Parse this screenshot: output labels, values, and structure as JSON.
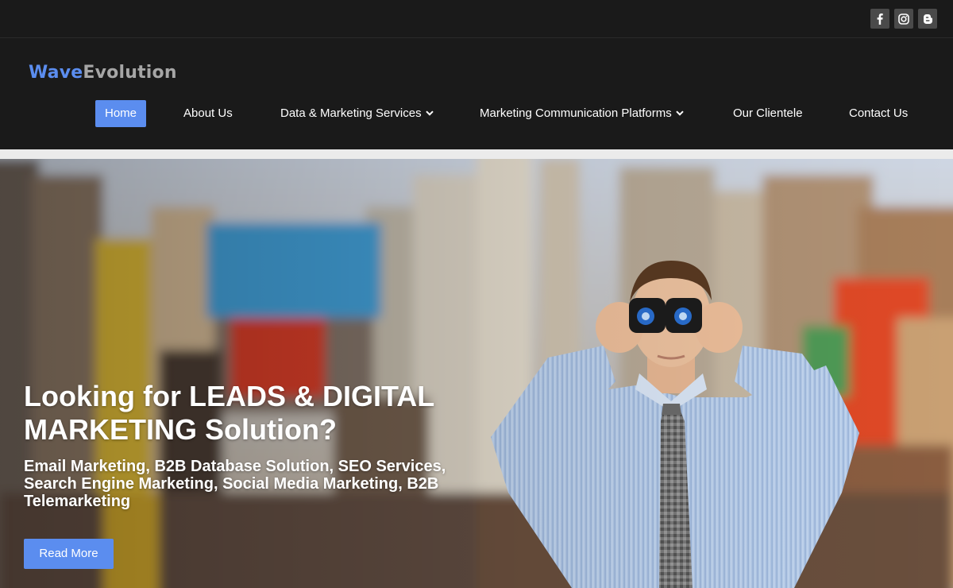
{
  "social": [
    {
      "name": "facebook",
      "icon": "facebook-icon"
    },
    {
      "name": "instagram",
      "icon": "instagram-icon"
    },
    {
      "name": "blogger",
      "icon": "blogger-icon"
    }
  ],
  "brand": {
    "part1": "Wave",
    "part2": "Evolution",
    "color1": "#5b8def",
    "color2": "#a6a6a6"
  },
  "nav": {
    "items": [
      {
        "label": "Home",
        "active": true
      },
      {
        "label": "About Us"
      },
      {
        "label": "Data & Marketing Services",
        "dropdown": true
      },
      {
        "label": "Marketing Communication Platforms",
        "dropdown": true
      },
      {
        "label": "Our Clientele"
      },
      {
        "label": "Contact Us"
      }
    ]
  },
  "hero": {
    "title": "Looking for LEADS & DIGITAL MARKETING Solution?",
    "subtitle": "Email Marketing, B2B Database Solution, SEO Services, Search Engine Marketing, Social Media Marketing, B2B Telemarketing",
    "button": "Read More"
  },
  "colors": {
    "accent": "#5b8def",
    "header_bg": "#1a1a1a",
    "divider": "#ebebeb"
  }
}
